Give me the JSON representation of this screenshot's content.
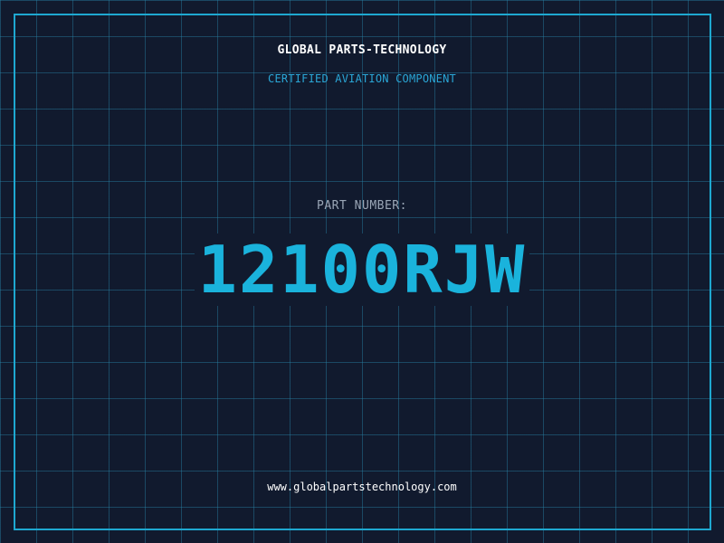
{
  "card": {
    "company": "GLOBAL PARTS-TECHNOLOGY",
    "subtitle": "CERTIFIED AVIATION COMPONENT",
    "part_number_label": "PART NUMBER:",
    "part_number": "12100RJW",
    "website": "www.globalpartstechnology.com"
  },
  "colors": {
    "background": "#111a2e",
    "grid": "#2882a5",
    "border": "#1ea8d0",
    "accent": "#1ab3dc",
    "label": "#9aa6b6",
    "text": "#ffffff"
  }
}
